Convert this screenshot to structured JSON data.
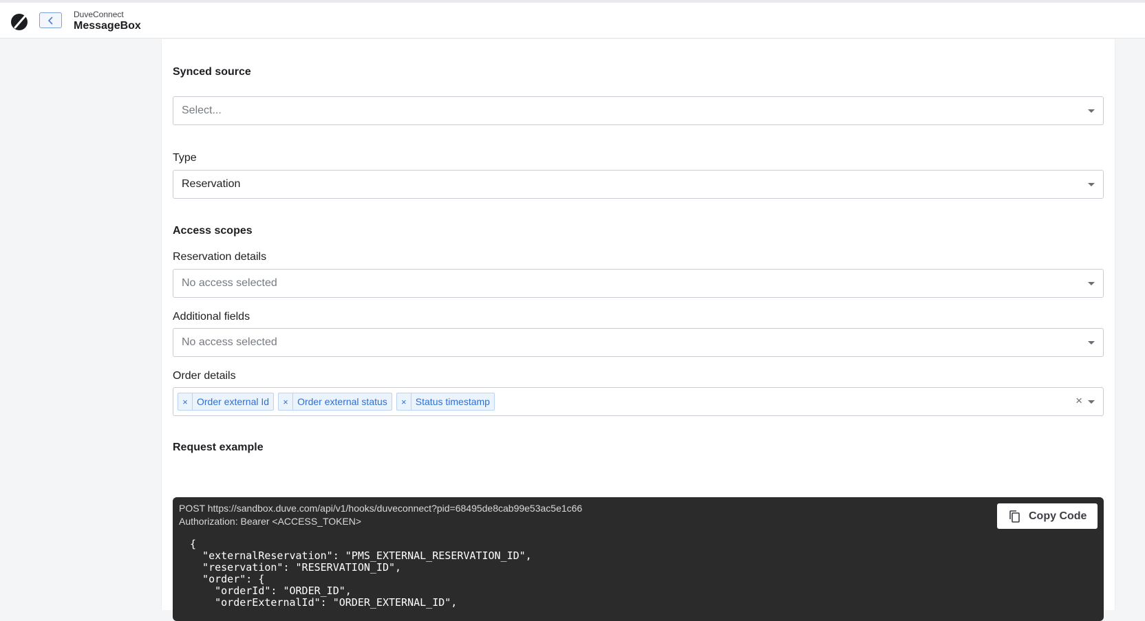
{
  "header": {
    "app_subtitle": "DuveConnect",
    "app_title": "MessageBox",
    "logo_icon": "duve-logo",
    "back_icon": "chevron-left-icon"
  },
  "form": {
    "synced_source": {
      "title": "Synced source",
      "placeholder": "Select..."
    },
    "type": {
      "label": "Type",
      "value": "Reservation"
    },
    "access_scopes": {
      "title": "Access scopes",
      "reservation_details": {
        "label": "Reservation details",
        "placeholder": "No access selected"
      },
      "additional_fields": {
        "label": "Additional fields",
        "placeholder": "No access selected"
      },
      "order_details": {
        "label": "Order details",
        "chips": [
          "Order external Id",
          "Order external status",
          "Status timestamp"
        ],
        "clear_symbol": "×",
        "remove_symbol": "×"
      }
    }
  },
  "request_example": {
    "title": "Request example",
    "request_line": "POST https://sandbox.duve.com/api/v1/hooks/duveconnect?pid=68495de8cab99e53ac5e1c66",
    "auth_line": "Authorization: Bearer <ACCESS_TOKEN>",
    "code": "{\n  \"externalReservation\": \"PMS_EXTERNAL_RESERVATION_ID\",\n  \"reservation\": \"RESERVATION_ID\",\n  \"order\": {\n    \"orderId\": \"ORDER_ID\",\n    \"orderExternalId\": \"ORDER_EXTERNAL_ID\",",
    "copy_label": "Copy Code",
    "copy_icon": "copy-icon"
  }
}
